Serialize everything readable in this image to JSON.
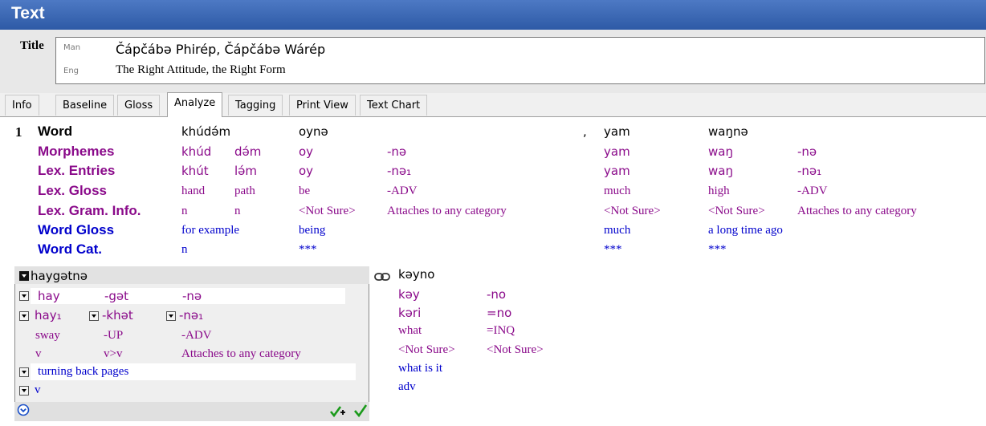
{
  "window": {
    "title": "Text"
  },
  "title_field": {
    "label": "Title",
    "vernacular": {
      "ws": "Man",
      "value": "Čápčábə Phirép, Čápčábə Wárép"
    },
    "analysis": {
      "ws": "Eng",
      "value": "The Right Attitude, the Right Form"
    }
  },
  "tabs": [
    "Info",
    "Baseline",
    "Gloss",
    "Analyze",
    "Tagging",
    "Print View",
    "Text Chart"
  ],
  "active_tab": "Analyze",
  "interlinear": {
    "segment_number": "1",
    "row_labels": {
      "word": "Word",
      "morphemes": "Morphemes",
      "lex_entries": "Lex. Entries",
      "lex_gloss": "Lex. Gloss",
      "lex_gram": "Lex. Gram. Info.",
      "word_gloss": "Word Gloss",
      "word_cat": "Word Cat."
    },
    "bundle1": {
      "word": "khúdə́m",
      "morphemes": [
        "khúd",
        "də́m"
      ],
      "lex_entries": [
        "khút",
        "lə́m"
      ],
      "lex_gloss": [
        "hand",
        "path"
      ],
      "lex_gram": [
        "n",
        "n"
      ],
      "word_gloss": "for example",
      "word_cat": "n"
    },
    "bundle2": {
      "word": "oynə",
      "morphemes": [
        "oy",
        "-nə"
      ],
      "lex_entries": [
        "oy",
        "-nə₁"
      ],
      "lex_gloss": [
        "be",
        "-ADV"
      ],
      "lex_gram": [
        "<Not Sure>",
        "Attaches to any category"
      ],
      "word_gloss": "being",
      "word_cat": "***"
    },
    "punct": ",",
    "bundle3": {
      "word": "yam",
      "morphemes": [
        "yam"
      ],
      "lex_entries": [
        "yam"
      ],
      "lex_gloss": [
        "much"
      ],
      "lex_gram": [
        "<Not Sure>"
      ],
      "word_gloss": "much",
      "word_cat": "***"
    },
    "bundle4": {
      "word": "waŋnə",
      "morphemes": [
        "waŋ",
        "-nə"
      ],
      "lex_entries": [
        "waŋ",
        "-nə₁"
      ],
      "lex_gloss": [
        "high",
        "-ADV"
      ],
      "lex_gram": [
        "<Not Sure>",
        "Attaches to any category"
      ],
      "word_gloss": "a long time ago",
      "word_cat": "***"
    }
  },
  "focus_box": {
    "word": "haygətnə",
    "morphemes": [
      "hay",
      "-gət",
      "-nə"
    ],
    "lex_entries": [
      "hay₁",
      "-khət",
      "-nə₁"
    ],
    "lex_gloss": [
      "sway",
      "-UP",
      "-ADV"
    ],
    "lex_gram": [
      "v",
      "v>v",
      "Attaches to any category"
    ],
    "word_gloss": "turning back pages",
    "word_cat": "v"
  },
  "bundle5": {
    "word": "kəyno",
    "morphemes": [
      "kəy",
      "-no"
    ],
    "lex_entries": [
      "kəri",
      "=no"
    ],
    "lex_gloss": [
      "what",
      "=INQ"
    ],
    "lex_gram": [
      "<Not Sure>",
      "<Not Sure>"
    ],
    "word_gloss": "what is it",
    "word_cat": "adv"
  },
  "colors": {
    "header": "#2e5aa6",
    "purple": "#8a0a8a",
    "blue": "#0000cc",
    "check_green": "#1a9a1a"
  },
  "icons": [
    "dropdown-icon",
    "link-icon",
    "approve-and-next-icon",
    "approve-icon",
    "expand-icon"
  ]
}
